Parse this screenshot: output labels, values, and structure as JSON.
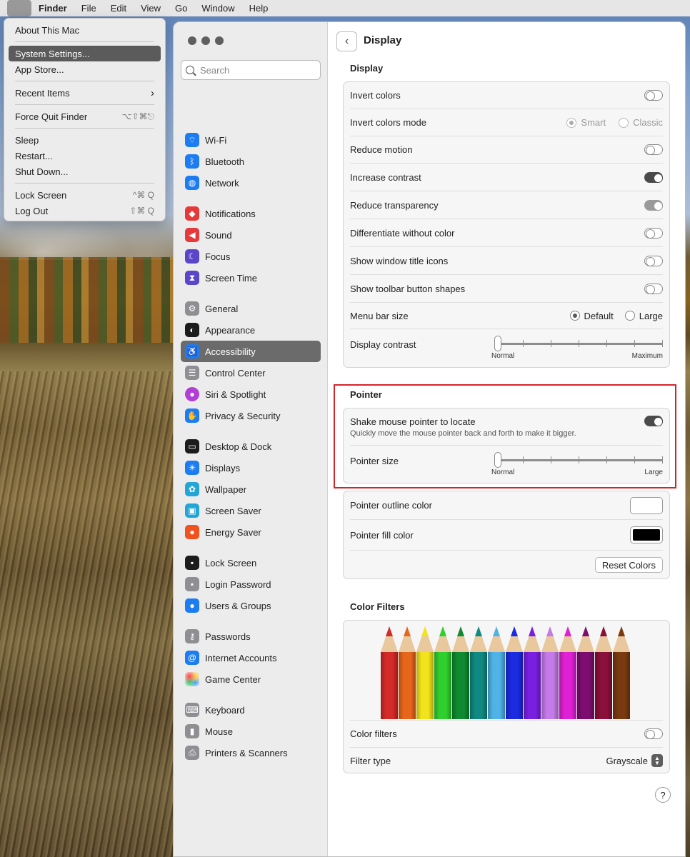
{
  "menubar": {
    "apple_icon": "apple-icon",
    "items": [
      "Finder",
      "File",
      "Edit",
      "View",
      "Go",
      "Window",
      "Help"
    ]
  },
  "apple_menu": {
    "about": "About This Mac",
    "system_settings": "System Settings...",
    "app_store": "App Store...",
    "recent_items": "Recent Items",
    "force_quit": "Force Quit Finder",
    "force_quit_shortcut": "⌥⇧⌘⎋",
    "sleep": "Sleep",
    "restart": "Restart...",
    "shut_down": "Shut Down...",
    "lock_screen": "Lock Screen",
    "lock_screen_shortcut": "^⌘ Q",
    "log_out": "Log Out",
    "log_out_shortcut": "⇧⌘ Q"
  },
  "search": {
    "placeholder": "Search"
  },
  "sidebar": {
    "items": [
      {
        "label": "Wi-Fi",
        "icon": "wifi-icon",
        "color": "#1c7cf2"
      },
      {
        "label": "Bluetooth",
        "icon": "bluetooth-icon",
        "color": "#1c7cf2"
      },
      {
        "label": "Network",
        "icon": "globe-icon",
        "color": "#1c7cf2"
      },
      {
        "label": "Notifications",
        "icon": "bell-icon",
        "color": "#e6393b"
      },
      {
        "label": "Sound",
        "icon": "speaker-icon",
        "color": "#e6393b"
      },
      {
        "label": "Focus",
        "icon": "moon-icon",
        "color": "#5b45c9"
      },
      {
        "label": "Screen Time",
        "icon": "hourglass-icon",
        "color": "#5b45c9"
      },
      {
        "label": "General",
        "icon": "gear-icon",
        "color": "#8e8e93"
      },
      {
        "label": "Appearance",
        "icon": "appearance-icon",
        "color": "#1c1c1c"
      },
      {
        "label": "Accessibility",
        "icon": "accessibility-icon",
        "color": "#1c7cf2"
      },
      {
        "label": "Control Center",
        "icon": "control-center-icon",
        "color": "#8e8e93"
      },
      {
        "label": "Siri & Spotlight",
        "icon": "siri-icon",
        "color": "#b13fd6"
      },
      {
        "label": "Privacy & Security",
        "icon": "hand-icon",
        "color": "#1c7cf2"
      },
      {
        "label": "Desktop & Dock",
        "icon": "dock-icon",
        "color": "#1c1c1c"
      },
      {
        "label": "Displays",
        "icon": "sun-icon",
        "color": "#1c7cf2"
      },
      {
        "label": "Wallpaper",
        "icon": "flower-icon",
        "color": "#23a6d5"
      },
      {
        "label": "Screen Saver",
        "icon": "screensaver-icon",
        "color": "#23a6d5"
      },
      {
        "label": "Energy Saver",
        "icon": "lightbulb-icon",
        "color": "#f0531f"
      },
      {
        "label": "Lock Screen",
        "icon": "lock-icon",
        "color": "#1c1c1c"
      },
      {
        "label": "Login Password",
        "icon": "padlock-icon",
        "color": "#8e8e93"
      },
      {
        "label": "Users & Groups",
        "icon": "users-icon",
        "color": "#1c7cf2"
      },
      {
        "label": "Passwords",
        "icon": "key-icon",
        "color": "#8e8e93"
      },
      {
        "label": "Internet Accounts",
        "icon": "at-icon",
        "color": "#1c7cf2"
      },
      {
        "label": "Game Center",
        "icon": "game-center-icon",
        "color": "#ffffff"
      },
      {
        "label": "Keyboard",
        "icon": "keyboard-icon",
        "color": "#8e8e93"
      },
      {
        "label": "Mouse",
        "icon": "mouse-icon",
        "color": "#8e8e93"
      },
      {
        "label": "Printers & Scanners",
        "icon": "printer-icon",
        "color": "#8e8e93"
      }
    ]
  },
  "main": {
    "title": "Display",
    "display_section": {
      "heading": "Display",
      "invert_colors": "Invert colors",
      "invert_colors_mode": "Invert colors mode",
      "mode_smart": "Smart",
      "mode_classic": "Classic",
      "reduce_motion": "Reduce motion",
      "increase_contrast": "Increase contrast",
      "reduce_transparency": "Reduce transparency",
      "differentiate_without_color": "Differentiate without color",
      "show_window_title_icons": "Show window title icons",
      "show_toolbar_button_shapes": "Show toolbar button shapes",
      "menu_bar_size": "Menu bar size",
      "menu_bar_default": "Default",
      "menu_bar_large": "Large",
      "display_contrast": "Display contrast",
      "contrast_min": "Normal",
      "contrast_max": "Maximum",
      "contrast_value": 0
    },
    "pointer_section": {
      "heading": "Pointer",
      "shake_to_locate": "Shake mouse pointer to locate",
      "shake_description": "Quickly move the mouse pointer back and forth to make it bigger.",
      "pointer_size": "Pointer size",
      "size_min": "Normal",
      "size_max": "Large",
      "size_value": 0
    },
    "pointer_colors": {
      "outline": "Pointer outline color",
      "outline_color": "#ffffff",
      "fill": "Pointer fill color",
      "fill_color": "#000000",
      "reset": "Reset Colors"
    },
    "color_filters": {
      "heading": "Color Filters",
      "pencil_colors": [
        "#d42a28",
        "#e8661c",
        "#f2e31c",
        "#2fd02e",
        "#0f8a30",
        "#0f8a82",
        "#4fb3e8",
        "#1b2be0",
        "#7a1fe0",
        "#c47ae8",
        "#e020d6",
        "#7d0d70",
        "#8a0f3a",
        "#7a3a10"
      ],
      "color_filters_label": "Color filters",
      "filter_type": "Filter type",
      "filter_value": "Grayscale"
    },
    "help": "?"
  }
}
